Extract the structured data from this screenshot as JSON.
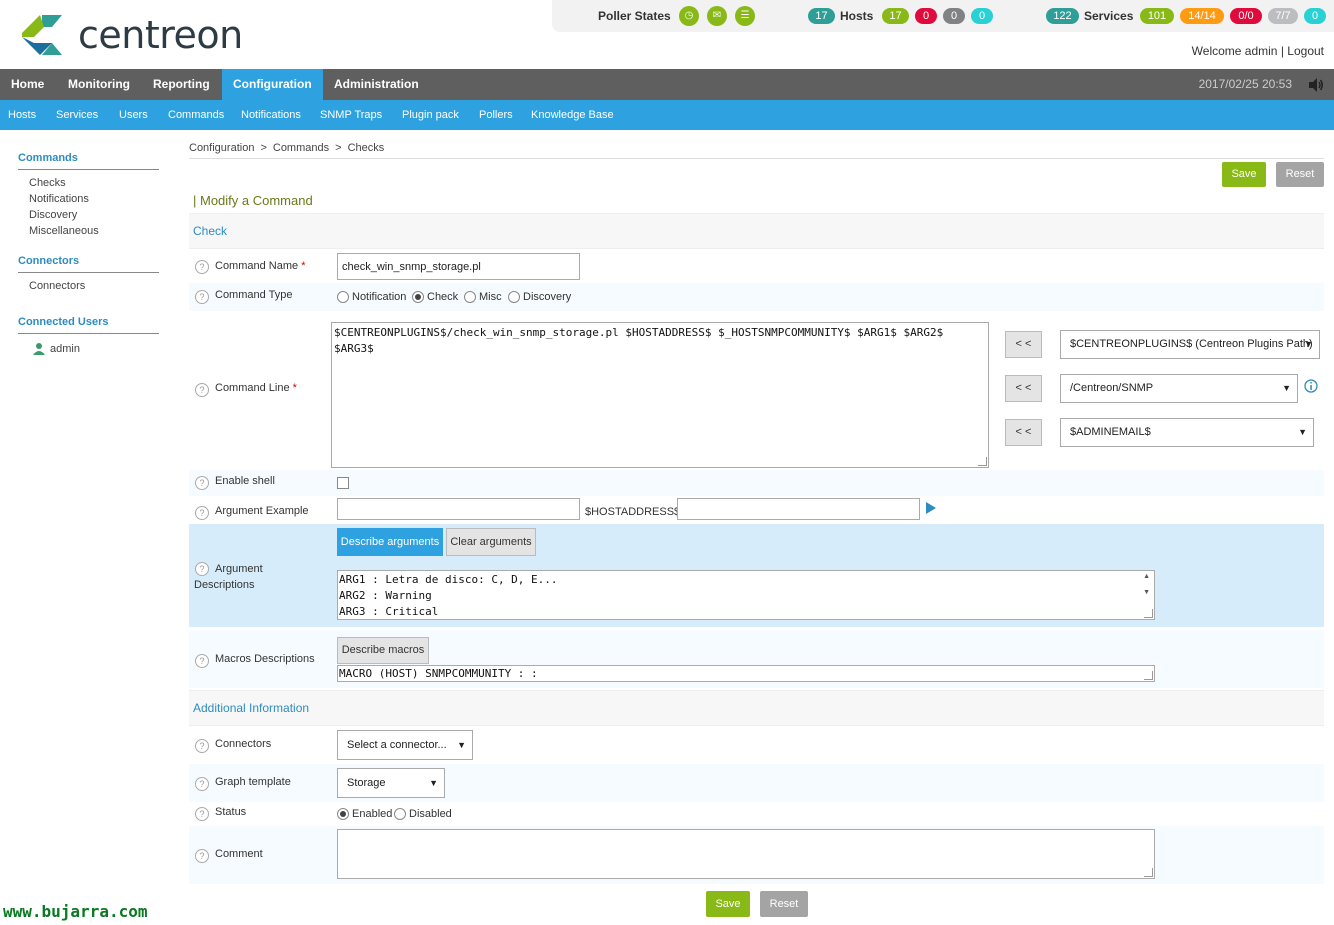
{
  "brand": {
    "name": "centreon",
    "footer": "www.bujarra.com"
  },
  "status_bar": {
    "poller_states_label": "Poller States",
    "hosts_count": "17",
    "hosts_label": "Hosts",
    "hosts_up": "17",
    "hosts_down": "0",
    "hosts_unreachable": "0",
    "hosts_pending": "0",
    "services_count": "122",
    "services_label": "Services",
    "services_ok": "101",
    "services_warning": "14/14",
    "services_critical": "0/0",
    "services_unknown": "7/7",
    "services_pending": "0",
    "colors": {
      "ok": "#88b917",
      "warning": "#ff9a13",
      "critical": "#e00b3d",
      "unknown": "#bcbdc0",
      "pending": "#2ad1d4",
      "total": "#2e9e97"
    }
  },
  "welcome": {
    "text": "Welcome admin",
    "separator": "|",
    "logout": "Logout"
  },
  "main_nav": [
    "Home",
    "Monitoring",
    "Reporting",
    "Configuration",
    "Administration"
  ],
  "main_nav_active": "Configuration",
  "datetime": "2017/02/25 20:53",
  "sub_nav": [
    "Hosts",
    "Services",
    "Users",
    "Commands",
    "Notifications",
    "SNMP Traps",
    "Plugin pack",
    "Pollers",
    "Knowledge Base"
  ],
  "sidebar": {
    "commands_title": "Commands",
    "commands_items": [
      "Checks",
      "Notifications",
      "Discovery",
      "Miscellaneous"
    ],
    "connectors_title": "Connectors",
    "connectors_items": [
      "Connectors"
    ],
    "users_title": "Connected Users",
    "users": [
      "admin"
    ]
  },
  "breadcrumb": [
    "Configuration",
    "Commands",
    "Checks"
  ],
  "breadcrumb_sep": ">",
  "buttons": {
    "save": "Save",
    "reset": "Reset"
  },
  "form": {
    "title": "| Modify a Command",
    "section_check": "Check",
    "section_additional": "Additional Information",
    "command_name_label": "Command Name",
    "command_name_value": "check_win_snmp_storage.pl",
    "command_type_label": "Command Type",
    "command_types": [
      "Notification",
      "Check",
      "Misc",
      "Discovery"
    ],
    "command_type_selected": "Check",
    "command_line_label": "Command Line",
    "command_line_value": "$CENTREONPLUGINS$/check_win_snmp_storage.pl $HOSTADDRESS$ $_HOSTSNMPCOMMUNITY$ $ARG1$ $ARG2$ $ARG3$",
    "insert_button": "< <",
    "macro_select_1": "$CENTREONPLUGINS$ (Centreon Plugins Path)",
    "macro_select_2": "/Centreon/SNMP",
    "macro_select_3": "$ADMINEMAIL$",
    "enable_shell_label": "Enable shell",
    "argument_example_label": "Argument Example",
    "hostaddress_label": "$HOSTADDRESS$",
    "argument_descriptions_label": "Argument Descriptions",
    "describe_arguments": "Describe arguments",
    "clear_arguments": "Clear arguments",
    "argument_descriptions": [
      "ARG1 : Letra de disco: C, D, E...",
      "ARG2 : Warning",
      "ARG3 : Critical"
    ],
    "macros_descriptions_label": "Macros Descriptions",
    "describe_macros": "Describe macros",
    "macros_value": "MACRO (HOST) SNMPCOMMUNITY : :",
    "connectors_label": "Connectors",
    "connectors_value": "Select a connector...",
    "graph_template_label": "Graph template",
    "graph_template_value": "Storage",
    "status_label": "Status",
    "status_options": [
      "Enabled",
      "Disabled"
    ],
    "status_selected": "Enabled",
    "comment_label": "Comment"
  }
}
